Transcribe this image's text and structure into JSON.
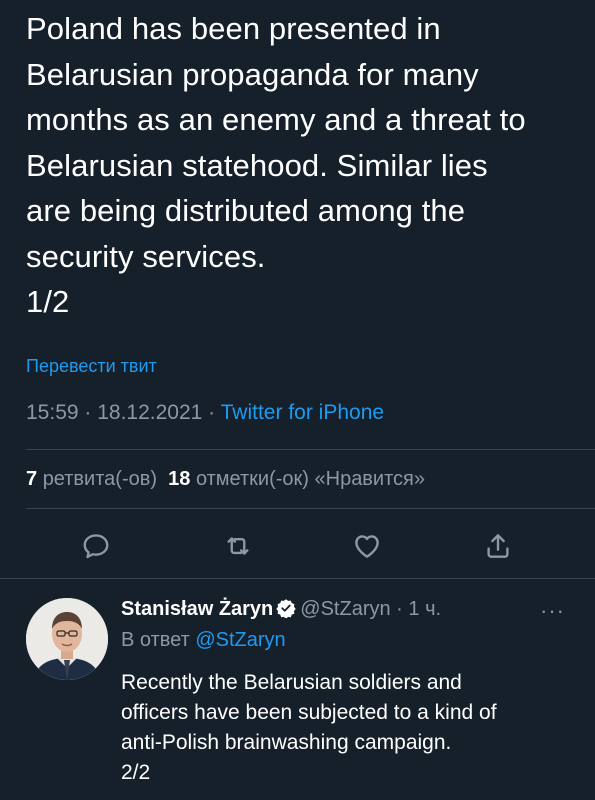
{
  "tweet": {
    "text": "Poland has been presented in\nBelarusian propaganda for many\nmonths as an enemy and a threat to\nBelarusian statehood. Similar lies\nare being distributed among the\nsecurity services.\n1/2",
    "translate_label": "Перевести твит",
    "time": "15:59",
    "date": "18.12.2021",
    "separator": " · ",
    "app": "Twitter for iPhone",
    "retweets_count": "7",
    "retweets_label": "ретвита(-ов)",
    "likes_count": "18",
    "likes_label": "отметки(-ок) «Нравится»"
  },
  "actions": {
    "reply_icon": "reply-icon",
    "retweet_icon": "retweet-icon",
    "like_icon": "heart-icon",
    "share_icon": "share-icon"
  },
  "reply": {
    "name": "Stanisław Żaryn",
    "handle": "@StZaryn",
    "time_sep": " · ",
    "time": "1 ч.",
    "more_label": "···",
    "reply_prefix": "В ответ ",
    "reply_mention": "@StZaryn",
    "text": "Recently the Belarusian soldiers and\nofficers have been subjected to a kind of\nanti-Polish brainwashing campaign.\n2/2"
  },
  "colors": {
    "background": "#15202b",
    "text": "#ffffff",
    "secondary": "#8b98a5",
    "accent": "#1d9bf0",
    "divider": "#38444d"
  }
}
